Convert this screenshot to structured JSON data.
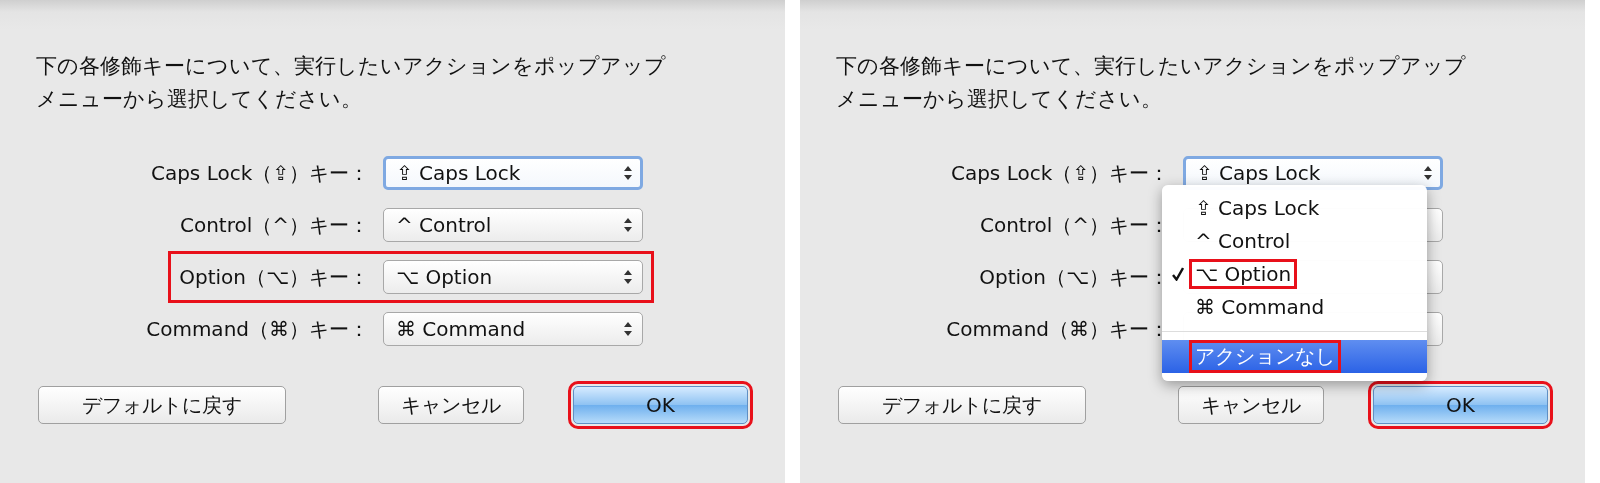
{
  "panels": [
    {
      "instruction": "下の各修飾キーについて、実行したいアクションをポップアップメニューから選択してください。",
      "rows": [
        {
          "label": "Caps Lock（⇪）キー：",
          "value": "⇪ Caps Lock",
          "focused": true,
          "annotated": false
        },
        {
          "label": "Control（^）キー：",
          "value": "^ Control",
          "focused": false,
          "annotated": false
        },
        {
          "label": "Option（⌥）キー：",
          "value": "⌥ Option",
          "focused": false,
          "annotated": true
        },
        {
          "label": "Command（⌘）キー：",
          "value": "⌘ Command",
          "focused": false,
          "annotated": false
        }
      ],
      "buttons": [
        {
          "label": "デフォルトに戻す",
          "default": false,
          "annotated": false
        },
        {
          "label": "キャンセル",
          "default": false,
          "annotated": false
        },
        {
          "label": "OK",
          "default": true,
          "annotated": true
        }
      ]
    },
    {
      "instruction": "下の各修飾キーについて、実行したいアクションをポップアップメニューから選択してください。",
      "rows": [
        {
          "label": "Caps Lock（⇪）キー：",
          "value": "⇪ Caps Lock",
          "focused": true,
          "annotated": false
        },
        {
          "label": "Control（^）キー：",
          "focused": false,
          "annotated": false
        },
        {
          "label": "Option（⌥）キー：",
          "focused": false,
          "annotated": false
        },
        {
          "label": "Command（⌘）キー：",
          "focused": false,
          "annotated": false
        }
      ],
      "menu": {
        "items": [
          {
            "label": "⇪ Caps Lock",
            "checked": false,
            "selected": false,
            "annotated": false
          },
          {
            "label": "^ Control",
            "checked": false,
            "selected": false,
            "annotated": false
          },
          {
            "label": "⌥ Option",
            "checked": true,
            "selected": false,
            "annotated": true
          },
          {
            "label": "⌘ Command",
            "checked": false,
            "selected": false,
            "annotated": false
          },
          {
            "kind": "separator"
          },
          {
            "label": "アクションなし",
            "checked": false,
            "selected": true,
            "annotated": true
          }
        ]
      },
      "buttons": [
        {
          "label": "デフォルトに戻す",
          "default": false,
          "annotated": false
        },
        {
          "label": "キャンセル",
          "default": false,
          "annotated": false
        },
        {
          "label": "OK",
          "default": true,
          "annotated": true
        }
      ]
    }
  ]
}
